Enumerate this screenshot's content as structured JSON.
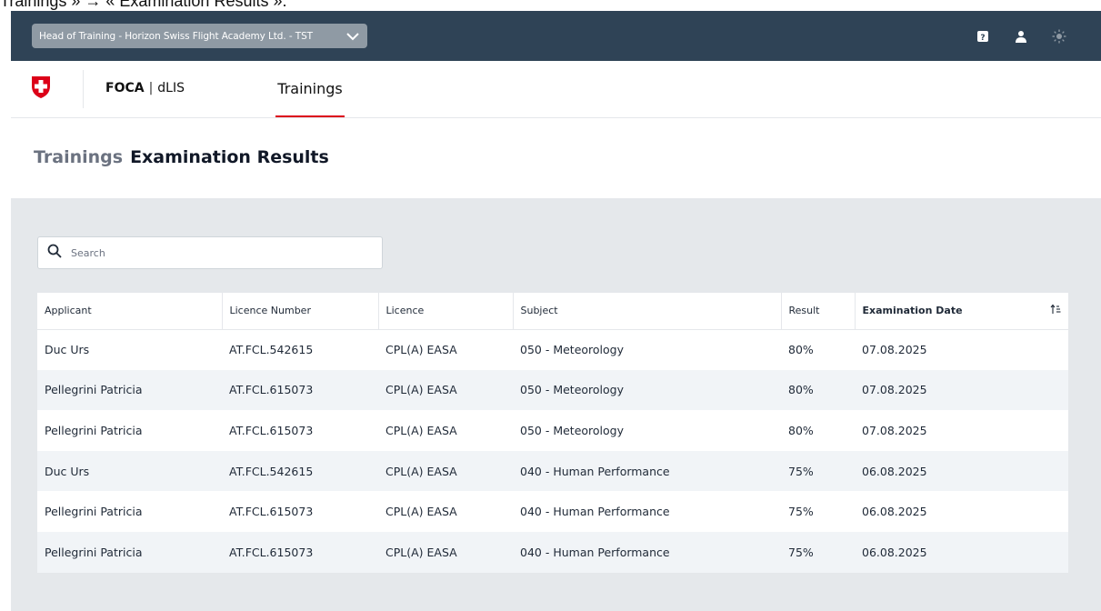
{
  "caption": "Trainings » → « Examination Results ».",
  "topbar": {
    "role_label": "Head of Training - Horizon Swiss Flight Academy Ltd. - TST",
    "icons": [
      "help-icon",
      "user-icon",
      "theme-sun-icon"
    ],
    "background": "#2f4356"
  },
  "header": {
    "brand_bold": "FOCA",
    "brand_separator": "|",
    "brand_light": "dLIS",
    "nav_trainings": "Trainings",
    "accent": "#dc0018"
  },
  "page": {
    "breadcrumb": "Trainings",
    "title": "Examination Results"
  },
  "search": {
    "placeholder": "Search"
  },
  "table": {
    "columns": [
      "Applicant",
      "Licence Number",
      "Licence",
      "Subject",
      "Result",
      "Examination Date"
    ],
    "rows": [
      [
        "Duc Urs",
        "AT.FCL.542615",
        "CPL(A) EASA",
        "050 - Meteorology",
        "80%",
        "07.08.2025"
      ],
      [
        "Pellegrini Patricia",
        "AT.FCL.615073",
        "CPL(A) EASA",
        "050 - Meteorology",
        "80%",
        "07.08.2025"
      ],
      [
        "Pellegrini Patricia",
        "AT.FCL.615073",
        "CPL(A) EASA",
        "050 - Meteorology",
        "80%",
        "07.08.2025"
      ],
      [
        "Duc Urs",
        "AT.FCL.542615",
        "CPL(A) EASA",
        "040 - Human Performance",
        "75%",
        "06.08.2025"
      ],
      [
        "Pellegrini Patricia",
        "AT.FCL.615073",
        "CPL(A) EASA",
        "040 - Human Performance",
        "75%",
        "06.08.2025"
      ],
      [
        "Pellegrini Patricia",
        "AT.FCL.615073",
        "CPL(A) EASA",
        "040 - Human Performance",
        "75%",
        "06.08.2025"
      ]
    ]
  }
}
